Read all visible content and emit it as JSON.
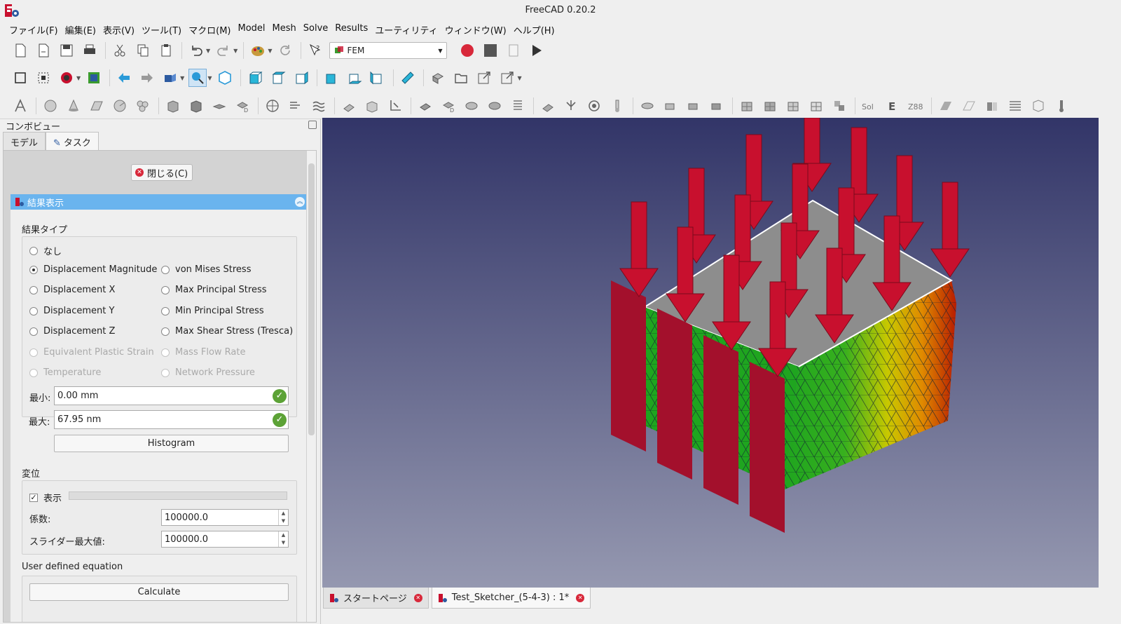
{
  "window": {
    "title": "FreeCAD 0.20.2"
  },
  "menu": [
    "ファイル(F)",
    "編集(E)",
    "表示(V)",
    "ツール(T)",
    "マクロ(M)",
    "Model",
    "Mesh",
    "Solve",
    "Results",
    "ユーティリティ",
    "ウィンドウ(W)",
    "ヘルプ(H)"
  ],
  "toolbar": {
    "workbench": "FEM"
  },
  "combo": {
    "title": "コンボビュー",
    "tabs": [
      "モデル",
      "タスク"
    ],
    "close_label": "閉じる(C)",
    "panel_title": "結果表示",
    "result_type_label": "結果タイプ",
    "radios": {
      "none": "なし",
      "disp_mag": "Displacement Magnitude",
      "disp_x": "Displacement X",
      "disp_y": "Displacement Y",
      "disp_z": "Displacement Z",
      "plastic": "Equivalent Plastic Strain",
      "temp": "Temperature",
      "von_mises": "von Mises Stress",
      "max_principal": "Max Principal Stress",
      "min_principal": "Min Principal Stress",
      "max_shear": "Max Shear Stress (Tresca)",
      "mass_flow": "Mass Flow Rate",
      "net_pressure": "Network Pressure"
    },
    "selected_result": "Displacement Magnitude",
    "min_label": "最小:",
    "min_value": "0.00 mm",
    "max_label": "最大:",
    "max_value": "67.95 nm",
    "histogram_label": "Histogram",
    "displacement_label": "変位",
    "show_label": "表示",
    "show_checked": true,
    "factor_label": "係数:",
    "factor_value": "100000.0",
    "slider_max_label": "スライダー最大値:",
    "slider_max_value": "100000.0",
    "user_eq_label": "User defined equation",
    "calculate_label": "Calculate"
  },
  "doc_tabs": [
    "スタートページ",
    "Test_Sketcher_(5-4-3) : 1*"
  ],
  "colors": {
    "accent": "#6ab4ee",
    "arrow": "#c8102e",
    "record": "#d8283a"
  }
}
